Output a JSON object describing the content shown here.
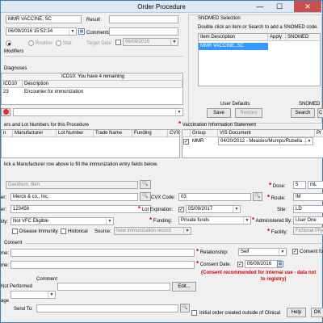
{
  "window": {
    "title": "Order Procedure",
    "minimize": "—",
    "maximize": "☐",
    "close": "✕"
  },
  "top": {
    "procedure": "MMR VACCINE, SC",
    "result_label": "Result",
    "datetime": "06/09/2016 15:52:34",
    "comments_label": "Comments",
    "priority_routine": "Routine",
    "priority_stat": "Stat",
    "target_date_label": "Target Date",
    "target_date": "06/09/2016",
    "modifiers_label": "Modifiers"
  },
  "diagnoses": {
    "label": "Diagnoses",
    "header_title": "ICD10: You have 4 remaining",
    "col_code": "ICD10",
    "col_desc": "Description",
    "code": "23",
    "desc": "Encounter for immunization"
  },
  "snomed": {
    "group_label": "SNOMED Selection",
    "instruction": "Double click an item or Search to add a SNOMED code.",
    "col_item": "Item Description",
    "col_apply": "Apply",
    "col_snomed": "SNOMED",
    "selected_item": "MMR VACCINE, SC",
    "user_defaults_label": "User Defaults",
    "save_button": "Save",
    "restore_button": "Restore",
    "snomed_label": "SNOMED",
    "search_button": "Search",
    "clear_button": "C"
  },
  "lots": {
    "label": "ers and Lot Numbers for this Procedure",
    "cols": [
      "n",
      "Manufacturer",
      "Lot Number",
      "Trade Name",
      "Funding",
      "CVX"
    ],
    "hint": "lick a Manufacturer row above to fill the immunization entry fields below."
  },
  "vis": {
    "label": "Vaccination Information Statement",
    "col_group": "Group",
    "col_doc": "VIS Document",
    "col_pr": "Pr",
    "group": "MMR",
    "doc": "04/20/2012 - Measles/Mumps/Rubella ..."
  },
  "entry": {
    "given_by": "Davidson, Ben",
    "manufacturer_label": "er:",
    "manufacturer": "Merck & co., Inc.",
    "lot_label": "er:",
    "lot": "123456",
    "vfc_label": "lity:",
    "vfc": "Not VFC Eligible",
    "disease_immunity": "Disease Immunity",
    "historical": "Historical",
    "source_label": "Source:",
    "source": "New immunization record",
    "cvx_label": "CVX Code:",
    "cvx": "03",
    "lot_exp_label": "Lot Expiration:",
    "lot_exp": "05/09/2017",
    "funding_label": "Funding:",
    "funding": "Private funds",
    "dose_label": "Dose:",
    "dose": "5",
    "dose_unit": "mL",
    "route_label": "Route:",
    "route": "IM",
    "site_label": "Site:",
    "site": "LD",
    "admin_by_label": "Administered By:",
    "admin_by": "User One",
    "facility_label": "Facility:",
    "facility": "Fictional Physi"
  },
  "consent": {
    "label": "Consent",
    "name_label": "me:",
    "name2_label": "me:",
    "relationship_label": "Relationship:",
    "relationship": "Self",
    "consent_for": "Consent for",
    "consent_date_label": "Consent Date:",
    "consent_date": "06/09/2016",
    "warning_line1": "(Consent recommended for internal use - data not",
    "warning_line2": "to registry)"
  },
  "bottom": {
    "not_performed_label": "Not Performed",
    "comment_label": "Comment",
    "edit_button": "Edit...",
    "age_label": "age",
    "send_to_label": "Send To:",
    "initial_order_label": "Initial order created outside of Clinical",
    "help_button": "Help",
    "ok_button": "OK"
  }
}
